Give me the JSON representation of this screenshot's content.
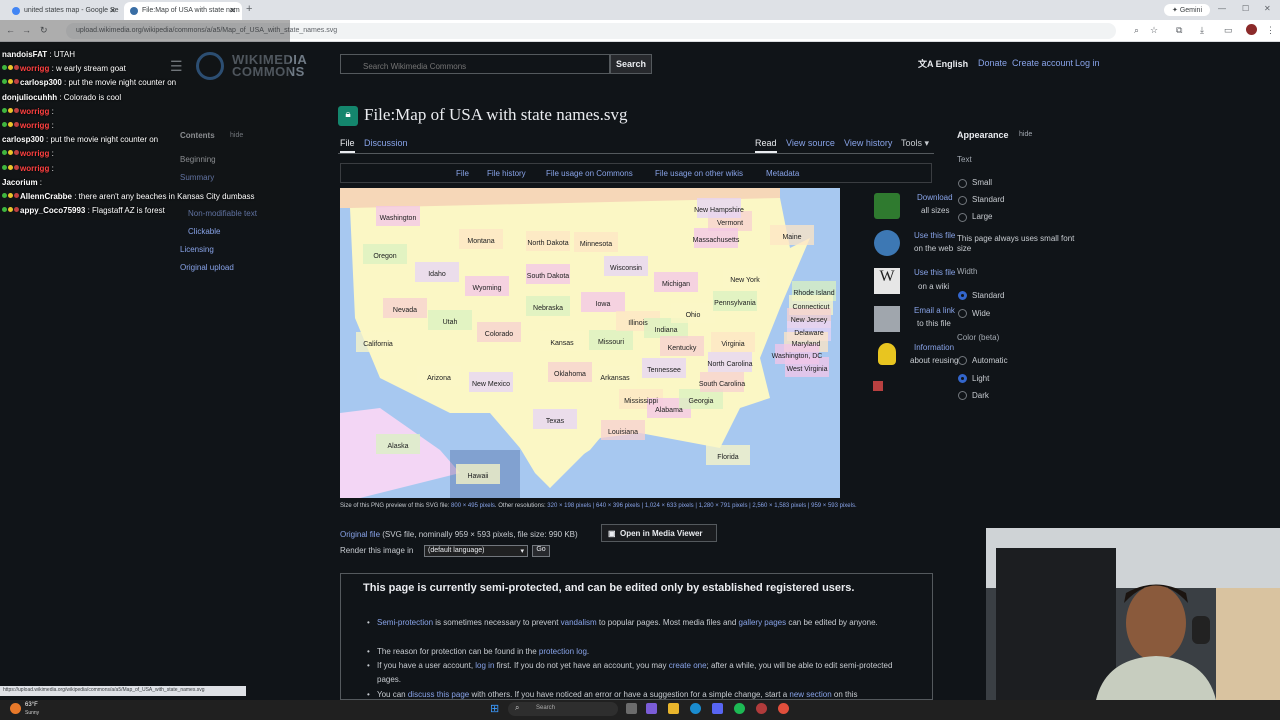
{
  "browser": {
    "tabs": [
      {
        "title": "united states map - Google Se"
      },
      {
        "title": "File:Map of USA with state nam"
      }
    ],
    "new_tab_symbol": "+",
    "gemini_label": "✦ Gemini",
    "url": "upload.wikimedia.org/wikipedia/commons/a/a5/Map_of_USA_with_state_names.svg"
  },
  "header": {
    "logo_line1": "WIKIMEDIA",
    "logo_line2": "COMMONS",
    "search_placeholder": "Search Wikimedia Commons",
    "search_button": "Search",
    "language": "English",
    "links": [
      "Donate",
      "Create account",
      "Log in"
    ]
  },
  "title": {
    "text": "File:Map of USA with state names.svg"
  },
  "page_tabs": {
    "left": [
      "File",
      "Discussion"
    ],
    "right": [
      "Read",
      "View source",
      "View history",
      "Tools ▾"
    ]
  },
  "sub_tabs": [
    "File",
    "File history",
    "File usage on Commons",
    "File usage on other wikis",
    "Metadata"
  ],
  "map": {
    "states": [
      "Washington",
      "Oregon",
      "California",
      "Nevada",
      "Idaho",
      "Montana",
      "Wyoming",
      "Utah",
      "Arizona",
      "Colorado",
      "New Mexico",
      "North Dakota",
      "South Dakota",
      "Nebraska",
      "Kansas",
      "Oklahoma",
      "Texas",
      "Minnesota",
      "Iowa",
      "Missouri",
      "Arkansas",
      "Louisiana",
      "Wisconsin",
      "Illinois",
      "Michigan",
      "Indiana",
      "Ohio",
      "Kentucky",
      "Tennessee",
      "Mississippi",
      "Alabama",
      "Georgia",
      "Florida",
      "South Carolina",
      "North Carolina",
      "Virginia",
      "West Virginia",
      "Pennsylvania",
      "New York",
      "Vermont",
      "New Hampshire",
      "Maine",
      "Massachusetts",
      "Rhode Island",
      "Connecticut",
      "New Jersey",
      "Delaware",
      "Maryland",
      "Washington, DC",
      "Alaska",
      "Hawaii"
    ]
  },
  "file_actions": [
    {
      "link": "Download",
      "text": "all sizes"
    },
    {
      "link": "Use this file",
      "text": "on the web"
    },
    {
      "link": "Use this file",
      "text": "on a wiki"
    },
    {
      "link": "Email a link",
      "text": "to this file"
    },
    {
      "link": "Information",
      "text": "about reusing"
    }
  ],
  "appearance": {
    "title": "Appearance",
    "hide": "hide",
    "text_heading": "Text",
    "text_options": [
      "Small",
      "Standard",
      "Large"
    ],
    "text_note": "This page always uses small font size",
    "width_heading": "Width",
    "width_options": [
      "Standard",
      "Wide"
    ],
    "color_heading": "Color (beta)",
    "color_options": [
      "Automatic",
      "Light",
      "Dark"
    ]
  },
  "toc": {
    "heading": "Contents",
    "hide": "hide",
    "items": [
      "Beginning",
      "Summary",
      "Non-modifiable text",
      "Clickable",
      "Licensing",
      "Original upload"
    ]
  },
  "file_info": {
    "size_prefix": "Size of this PNG preview of this SVG file:",
    "preview_size": "800 × 495 pixels",
    "other_res_label": ". Other resolutions:",
    "other_res": "320 × 198 pixels | 640 × 396 pixels | 1,024 × 633 pixels | 1,280 × 791 pixels | 2,560 × 1,583 pixels | 959 × 593 pixels.",
    "original_file": "Original file",
    "original_details": " (SVG file, nominally 959 × 593 pixels, file size: 990 KB)",
    "media_viewer": "Open in Media Viewer",
    "render_label": "Render this image in",
    "render_select": "(default language)",
    "go": "Go"
  },
  "protection": {
    "title": "This page is currently semi-protected, and can be edited only by established registered users.",
    "bullets": [
      {
        "parts": [
          [
            "Semi-protection",
            true
          ],
          [
            " is sometimes necessary to prevent ",
            false
          ],
          [
            "vandalism",
            true
          ],
          [
            " to popular pages. Most media files and ",
            false
          ],
          [
            "gallery pages",
            true
          ],
          [
            " can be edited by anyone.",
            false
          ]
        ]
      },
      {
        "parts": [
          [
            "The reason for protection can be found in the ",
            false
          ],
          [
            "protection log",
            true
          ],
          [
            ".",
            false
          ]
        ]
      },
      {
        "parts": [
          [
            "If you have a user account, ",
            false
          ],
          [
            "log in",
            true
          ],
          [
            " first. If you do not yet have an account, you may ",
            false
          ],
          [
            "create one",
            true
          ],
          [
            "; after a while, you will be able to edit semi-protected pages.",
            false
          ]
        ]
      },
      {
        "parts": [
          [
            "You can ",
            false
          ],
          [
            "discuss this page",
            true
          ],
          [
            " with others. If you have noticed an error or have a suggestion for a simple change, start a ",
            false
          ],
          [
            "new section",
            true
          ],
          [
            " on this",
            false
          ]
        ]
      }
    ]
  },
  "chat": [
    {
      "user": "nandoisFAT",
      "msg": ": UTAH",
      "color": "#ffffff"
    },
    {
      "user": "worrigg",
      "msg": ": w early stream goat",
      "color": "#ff4040"
    },
    {
      "user": "carlosp300",
      "msg": ": put the movie night counter on",
      "color": "#ffffff"
    },
    {
      "user": "donjuliocuhhh",
      "msg": ": Colorado is cool",
      "color": "#ffffff"
    },
    {
      "user": "worrigg",
      "msg": ":",
      "color": "#ff4040"
    },
    {
      "user": "worrigg",
      "msg": ":",
      "color": "#ff4040"
    },
    {
      "user": "carlosp300",
      "msg": ": put the movie night counter on",
      "color": "#ffffff"
    },
    {
      "user": "worrigg",
      "msg": ":",
      "color": "#ff4040"
    },
    {
      "user": "worrigg",
      "msg": ":",
      "color": "#ff4040"
    },
    {
      "user": "Jacorium",
      "msg": ":",
      "color": "#ffffff"
    },
    {
      "user": "AllennCrabbe",
      "msg": ": there aren't any beaches in Kansas City dumbass",
      "color": "#ffffff"
    },
    {
      "user": "appy_Coco75993",
      "msg": ": Flagstaff AZ is forest",
      "color": "#ffffff"
    }
  ],
  "taskbar": {
    "temp": "63°F",
    "weather": "Sunny",
    "search": "Search",
    "status_url": "https://upload.wikimedia.org/wikipedia/commons/a/a5/Map_of_USA_with_state_names.svg"
  },
  "colors": {
    "link": "#88a3e8",
    "background": "#101418",
    "protect_green": "#14866d"
  }
}
